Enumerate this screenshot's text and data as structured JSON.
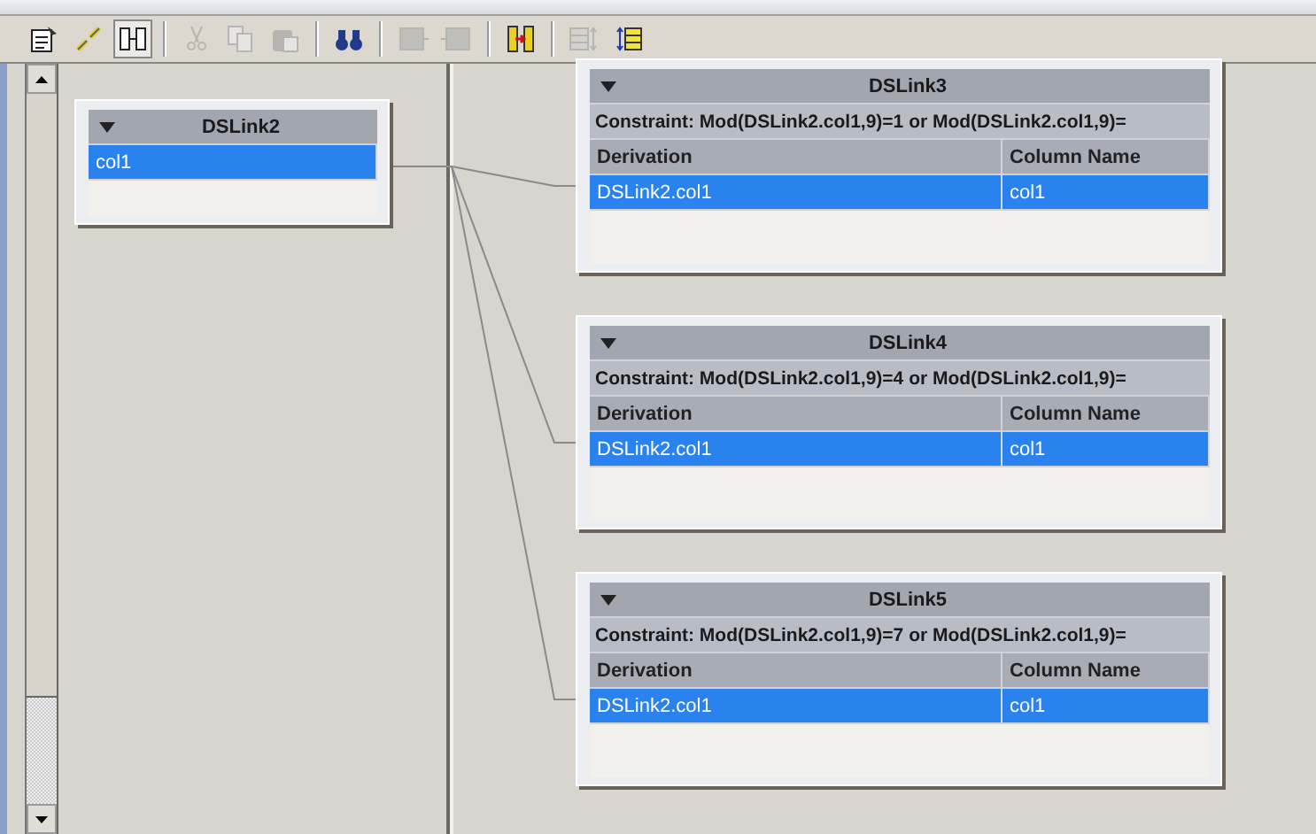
{
  "toolbar": [
    {
      "kind": "properties",
      "disabled": false
    },
    {
      "kind": "link",
      "disabled": false
    },
    {
      "kind": "columns",
      "disabled": false
    },
    {
      "kind": "separator"
    },
    {
      "kind": "cut",
      "disabled": true
    },
    {
      "kind": "copy",
      "disabled": true
    },
    {
      "kind": "paste",
      "disabled": true
    },
    {
      "kind": "separator"
    },
    {
      "kind": "find",
      "disabled": false
    },
    {
      "kind": "separator"
    },
    {
      "kind": "load",
      "disabled": true
    },
    {
      "kind": "save",
      "disabled": true
    },
    {
      "kind": "separator"
    },
    {
      "kind": "order",
      "disabled": false
    },
    {
      "kind": "separator"
    },
    {
      "kind": "grid",
      "disabled": true
    },
    {
      "kind": "rows",
      "disabled": false
    }
  ],
  "input_link": {
    "name": "DSLink2",
    "rows": [
      {
        "column": "col1",
        "selected": true
      }
    ]
  },
  "output_links": [
    {
      "name": "DSLink3",
      "constraint": "Constraint: Mod(DSLink2.col1,9)=1 or Mod(DSLink2.col1,9)=",
      "columns": [
        "Derivation",
        "Column Name"
      ],
      "rows": [
        {
          "derivation": "DSLink2.col1",
          "column_name": "col1",
          "selected": true
        }
      ]
    },
    {
      "name": "DSLink4",
      "constraint": "Constraint: Mod(DSLink2.col1,9)=4 or Mod(DSLink2.col1,9)=",
      "columns": [
        "Derivation",
        "Column Name"
      ],
      "rows": [
        {
          "derivation": "DSLink2.col1",
          "column_name": "col1",
          "selected": true
        }
      ]
    },
    {
      "name": "DSLink5",
      "constraint": "Constraint: Mod(DSLink2.col1,9)=7 or Mod(DSLink2.col1,9)=",
      "columns": [
        "Derivation",
        "Column Name"
      ],
      "rows": [
        {
          "derivation": "DSLink2.col1",
          "column_name": "col1",
          "selected": true
        }
      ]
    }
  ]
}
